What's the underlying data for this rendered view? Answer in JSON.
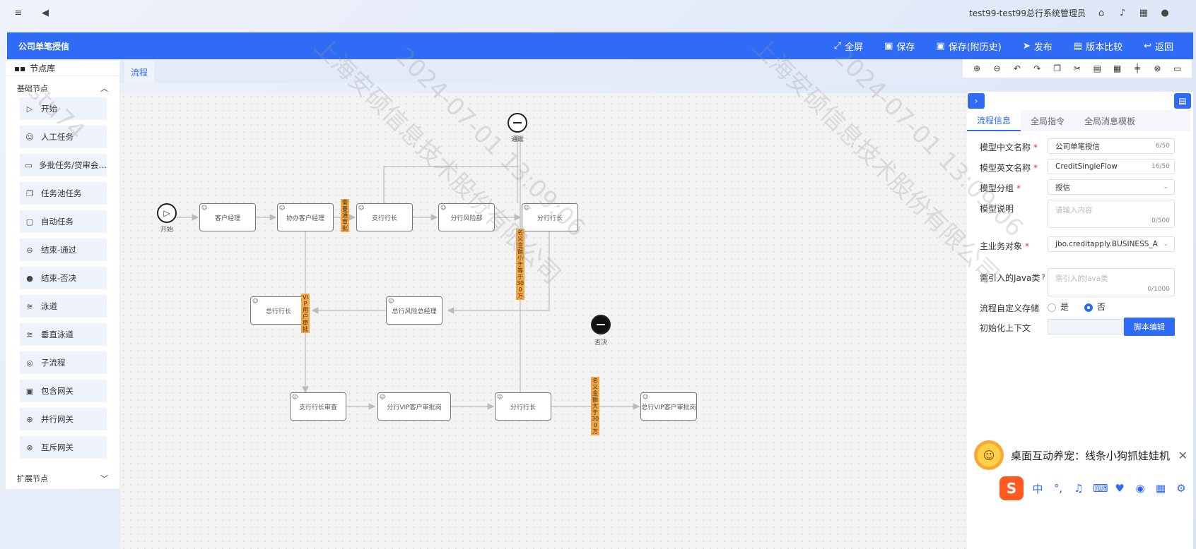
{
  "topbar": {
    "user": "test99-test99总行系统管理员"
  },
  "header": {
    "title": "公司单笔授信",
    "actions": [
      "全屏",
      "保存",
      "保存(附历史)",
      "发布",
      "版本比较",
      "返回"
    ]
  },
  "sidebar": {
    "title": "节点库",
    "basic_group": "基础节点",
    "items": [
      "开始",
      "人工任务",
      "多批任务/贷审会…",
      "任务池任务",
      "自动任务",
      "结束-通过",
      "结束-否决",
      "泳道",
      "垂直泳道",
      "子流程",
      "包含网关",
      "并行网关",
      "互斥网关"
    ],
    "ext_group": "扩展节点"
  },
  "tabs": {
    "flow": "流程"
  },
  "canvas": {
    "start_label": "开始",
    "pass_label": "通过",
    "reject_label": "否决",
    "nodes": {
      "n1": "客户经理",
      "n2": "协办客户经理",
      "n3": "支行行长",
      "n4": "分行风险部",
      "n5": "分行行长",
      "n6": "总行风险总经理",
      "n7": "总行行长",
      "n8": "支行行长审查",
      "n9": "分行VIP客户审批岗",
      "n10": "分行行长",
      "n11": "总行VIP客户审批岗"
    },
    "conditions": {
      "c1": "需要通审批",
      "c2": "名义金额小于等于300万",
      "c3": "VIP用户审批",
      "c4": "名义金额大于300万"
    }
  },
  "panel": {
    "tabs": [
      "流程信息",
      "全局指令",
      "全局消息模板"
    ],
    "fields": {
      "cn_name_label": "模型中文名称",
      "cn_name_value": "公司单笔授信",
      "cn_name_count": "6/50",
      "en_name_label": "模型英文名称",
      "en_name_value": "CreditSingleFlow",
      "en_name_count": "16/50",
      "group_label": "模型分组",
      "group_value": "授信",
      "desc_label": "模型说明",
      "desc_placeholder": "请输入内容",
      "desc_count": "0/500",
      "biz_label": "主业务对象",
      "biz_value": "jbo.creditapply.BUSINESS_A",
      "java_label": "需引入的Java类",
      "java_placeholder": "需引入的Java类",
      "java_count": "0/1000",
      "storage_label": "流程自定义存储",
      "storage_yes": "是",
      "storage_no": "否",
      "ctx_label": "初始化上下文",
      "script_btn": "脚本编辑"
    }
  },
  "popup": {
    "text": "桌面互动养宠：线条小狗抓娃娃机"
  },
  "ime": {
    "logo": "S",
    "lang": "中"
  },
  "watermark": {
    "text1": "上海安硕信息技术股份有限公司",
    "text2": "2024-07-01 13:09:06",
    "text3": "stu74"
  }
}
